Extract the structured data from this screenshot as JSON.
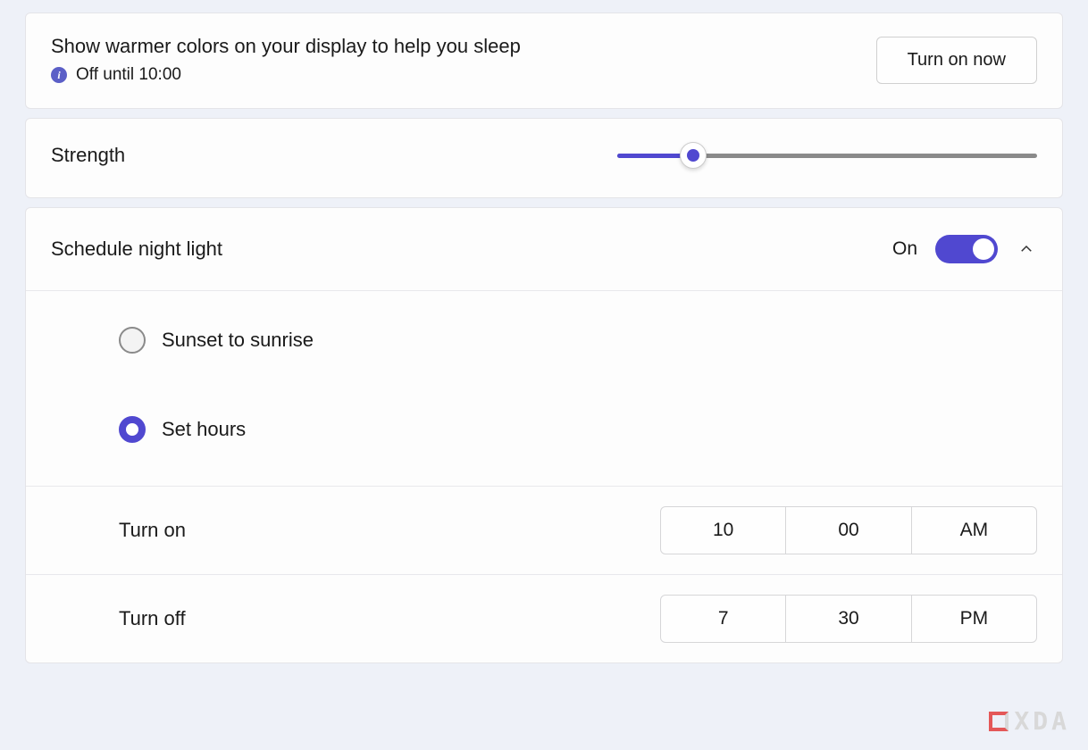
{
  "header": {
    "title": "Show warmer colors on your display to help you sleep",
    "status": "Off until 10:00",
    "button_label": "Turn on now"
  },
  "strength": {
    "label": "Strength",
    "value_percent": 18
  },
  "schedule": {
    "title": "Schedule night light",
    "state_label": "On",
    "on": true,
    "expanded": true,
    "options": {
      "sunset": "Sunset to sunrise",
      "sethours": "Set hours",
      "selected": "sethours"
    },
    "turn_on": {
      "label": "Turn on",
      "hour": "10",
      "minute": "00",
      "period": "AM"
    },
    "turn_off": {
      "label": "Turn off",
      "hour": "7",
      "minute": "30",
      "period": "PM"
    }
  },
  "watermark": "XDA",
  "colors": {
    "accent": "#5048d0"
  }
}
